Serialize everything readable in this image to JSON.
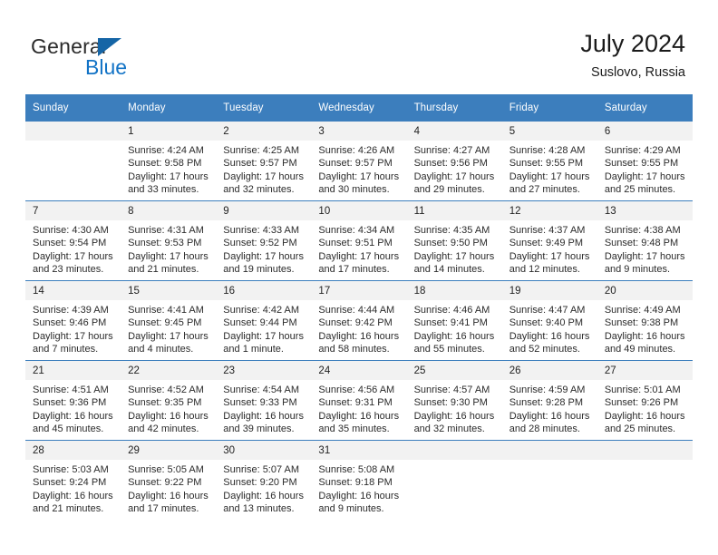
{
  "brand": {
    "name_part1": "General",
    "name_part2": "Blue",
    "triangle_color": "#1565a6",
    "blue_color": "#1273c6"
  },
  "header": {
    "title": "July 2024",
    "subtitle": "Suslovo, Russia"
  },
  "theme": {
    "header_blue": "#3c7ebd",
    "daynum_band": "#f2f2f2",
    "text": "#2b2b2b"
  },
  "columns": [
    "Sunday",
    "Monday",
    "Tuesday",
    "Wednesday",
    "Thursday",
    "Friday",
    "Saturday"
  ],
  "labels": {
    "sunrise_prefix": "Sunrise:",
    "sunset_prefix": "Sunset:",
    "daylight_prefix": "Daylight:"
  },
  "weeks": [
    {
      "band": "gray",
      "days": [
        {
          "num": "",
          "line1": "",
          "line2": "",
          "line3": "",
          "line4": ""
        },
        {
          "num": "1",
          "line1": "Sunrise: 4:24 AM",
          "line2": "Sunset: 9:58 PM",
          "line3": "Daylight: 17 hours",
          "line4": "and 33 minutes."
        },
        {
          "num": "2",
          "line1": "Sunrise: 4:25 AM",
          "line2": "Sunset: 9:57 PM",
          "line3": "Daylight: 17 hours",
          "line4": "and 32 minutes."
        },
        {
          "num": "3",
          "line1": "Sunrise: 4:26 AM",
          "line2": "Sunset: 9:57 PM",
          "line3": "Daylight: 17 hours",
          "line4": "and 30 minutes."
        },
        {
          "num": "4",
          "line1": "Sunrise: 4:27 AM",
          "line2": "Sunset: 9:56 PM",
          "line3": "Daylight: 17 hours",
          "line4": "and 29 minutes."
        },
        {
          "num": "5",
          "line1": "Sunrise: 4:28 AM",
          "line2": "Sunset: 9:55 PM",
          "line3": "Daylight: 17 hours",
          "line4": "and 27 minutes."
        },
        {
          "num": "6",
          "line1": "Sunrise: 4:29 AM",
          "line2": "Sunset: 9:55 PM",
          "line3": "Daylight: 17 hours",
          "line4": "and 25 minutes."
        }
      ]
    },
    {
      "band": "gray",
      "days": [
        {
          "num": "7",
          "line1": "Sunrise: 4:30 AM",
          "line2": "Sunset: 9:54 PM",
          "line3": "Daylight: 17 hours",
          "line4": "and 23 minutes."
        },
        {
          "num": "8",
          "line1": "Sunrise: 4:31 AM",
          "line2": "Sunset: 9:53 PM",
          "line3": "Daylight: 17 hours",
          "line4": "and 21 minutes."
        },
        {
          "num": "9",
          "line1": "Sunrise: 4:33 AM",
          "line2": "Sunset: 9:52 PM",
          "line3": "Daylight: 17 hours",
          "line4": "and 19 minutes."
        },
        {
          "num": "10",
          "line1": "Sunrise: 4:34 AM",
          "line2": "Sunset: 9:51 PM",
          "line3": "Daylight: 17 hours",
          "line4": "and 17 minutes."
        },
        {
          "num": "11",
          "line1": "Sunrise: 4:35 AM",
          "line2": "Sunset: 9:50 PM",
          "line3": "Daylight: 17 hours",
          "line4": "and 14 minutes."
        },
        {
          "num": "12",
          "line1": "Sunrise: 4:37 AM",
          "line2": "Sunset: 9:49 PM",
          "line3": "Daylight: 17 hours",
          "line4": "and 12 minutes."
        },
        {
          "num": "13",
          "line1": "Sunrise: 4:38 AM",
          "line2": "Sunset: 9:48 PM",
          "line3": "Daylight: 17 hours",
          "line4": "and 9 minutes."
        }
      ]
    },
    {
      "band": "gray",
      "days": [
        {
          "num": "14",
          "line1": "Sunrise: 4:39 AM",
          "line2": "Sunset: 9:46 PM",
          "line3": "Daylight: 17 hours",
          "line4": "and 7 minutes."
        },
        {
          "num": "15",
          "line1": "Sunrise: 4:41 AM",
          "line2": "Sunset: 9:45 PM",
          "line3": "Daylight: 17 hours",
          "line4": "and 4 minutes."
        },
        {
          "num": "16",
          "line1": "Sunrise: 4:42 AM",
          "line2": "Sunset: 9:44 PM",
          "line3": "Daylight: 17 hours",
          "line4": "and 1 minute."
        },
        {
          "num": "17",
          "line1": "Sunrise: 4:44 AM",
          "line2": "Sunset: 9:42 PM",
          "line3": "Daylight: 16 hours",
          "line4": "and 58 minutes."
        },
        {
          "num": "18",
          "line1": "Sunrise: 4:46 AM",
          "line2": "Sunset: 9:41 PM",
          "line3": "Daylight: 16 hours",
          "line4": "and 55 minutes."
        },
        {
          "num": "19",
          "line1": "Sunrise: 4:47 AM",
          "line2": "Sunset: 9:40 PM",
          "line3": "Daylight: 16 hours",
          "line4": "and 52 minutes."
        },
        {
          "num": "20",
          "line1": "Sunrise: 4:49 AM",
          "line2": "Sunset: 9:38 PM",
          "line3": "Daylight: 16 hours",
          "line4": "and 49 minutes."
        }
      ]
    },
    {
      "band": "gray",
      "days": [
        {
          "num": "21",
          "line1": "Sunrise: 4:51 AM",
          "line2": "Sunset: 9:36 PM",
          "line3": "Daylight: 16 hours",
          "line4": "and 45 minutes."
        },
        {
          "num": "22",
          "line1": "Sunrise: 4:52 AM",
          "line2": "Sunset: 9:35 PM",
          "line3": "Daylight: 16 hours",
          "line4": "and 42 minutes."
        },
        {
          "num": "23",
          "line1": "Sunrise: 4:54 AM",
          "line2": "Sunset: 9:33 PM",
          "line3": "Daylight: 16 hours",
          "line4": "and 39 minutes."
        },
        {
          "num": "24",
          "line1": "Sunrise: 4:56 AM",
          "line2": "Sunset: 9:31 PM",
          "line3": "Daylight: 16 hours",
          "line4": "and 35 minutes."
        },
        {
          "num": "25",
          "line1": "Sunrise: 4:57 AM",
          "line2": "Sunset: 9:30 PM",
          "line3": "Daylight: 16 hours",
          "line4": "and 32 minutes."
        },
        {
          "num": "26",
          "line1": "Sunrise: 4:59 AM",
          "line2": "Sunset: 9:28 PM",
          "line3": "Daylight: 16 hours",
          "line4": "and 28 minutes."
        },
        {
          "num": "27",
          "line1": "Sunrise: 5:01 AM",
          "line2": "Sunset: 9:26 PM",
          "line3": "Daylight: 16 hours",
          "line4": "and 25 minutes."
        }
      ]
    },
    {
      "band": "gray",
      "days": [
        {
          "num": "28",
          "line1": "Sunrise: 5:03 AM",
          "line2": "Sunset: 9:24 PM",
          "line3": "Daylight: 16 hours",
          "line4": "and 21 minutes."
        },
        {
          "num": "29",
          "line1": "Sunrise: 5:05 AM",
          "line2": "Sunset: 9:22 PM",
          "line3": "Daylight: 16 hours",
          "line4": "and 17 minutes."
        },
        {
          "num": "30",
          "line1": "Sunrise: 5:07 AM",
          "line2": "Sunset: 9:20 PM",
          "line3": "Daylight: 16 hours",
          "line4": "and 13 minutes."
        },
        {
          "num": "31",
          "line1": "Sunrise: 5:08 AM",
          "line2": "Sunset: 9:18 PM",
          "line3": "Daylight: 16 hours",
          "line4": "and 9 minutes."
        },
        {
          "num": "",
          "line1": "",
          "line2": "",
          "line3": "",
          "line4": ""
        },
        {
          "num": "",
          "line1": "",
          "line2": "",
          "line3": "",
          "line4": ""
        },
        {
          "num": "",
          "line1": "",
          "line2": "",
          "line3": "",
          "line4": ""
        }
      ]
    }
  ]
}
